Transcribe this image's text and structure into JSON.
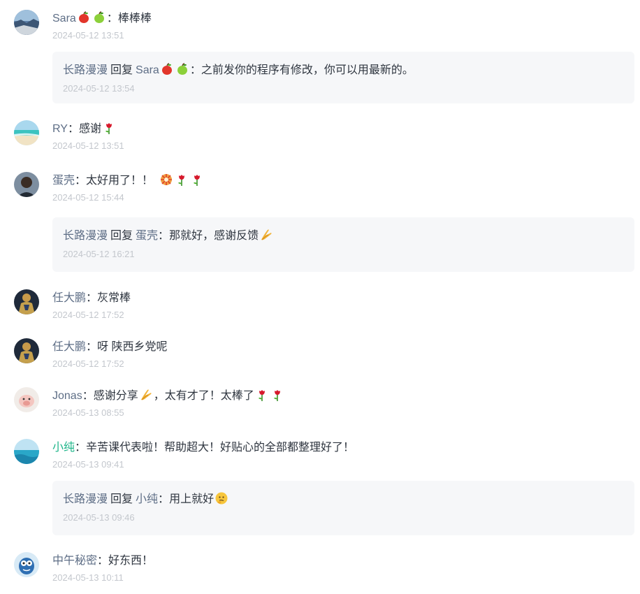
{
  "colon": "：",
  "reply_keyword": "回复",
  "comments": [
    {
      "author": "Sara",
      "author_emoji": [
        "apple-red-icon",
        "apple-green-icon"
      ],
      "text": "棒棒棒",
      "time": "2024-05-12 13:51",
      "avatar": "avatar-landscape-rocks",
      "replies": [
        {
          "author": "长路漫漫",
          "target": "Sara",
          "target_emoji": [
            "apple-red-icon",
            "apple-green-icon"
          ],
          "text": "之前发你的程序有修改，你可以用最新的。",
          "time": "2024-05-12 13:54"
        }
      ]
    },
    {
      "author": "RY",
      "text": "感谢",
      "text_emoji_after": [
        "rose-icon"
      ],
      "time": "2024-05-12 13:51",
      "avatar": "avatar-beach"
    },
    {
      "author": "蛋壳",
      "text": "太好用了！！",
      "text_emoji_after": [
        "party-popper-icon",
        "rose-icon",
        "rose-icon"
      ],
      "time": "2024-05-12 15:44",
      "avatar": "avatar-person-dark",
      "replies": [
        {
          "author": "长路漫漫",
          "target": "蛋壳",
          "text": "那就好，感谢反馈",
          "text_emoji_after": [
            "praying-hands-icon"
          ],
          "time": "2024-05-12 16:21"
        }
      ]
    },
    {
      "author": "任大鹏",
      "text": "灰常棒",
      "time": "2024-05-12 17:52",
      "avatar": "avatar-armored-figure"
    },
    {
      "author": "任大鹏",
      "text": "呀 陕西乡党呢",
      "time": "2024-05-12 17:52",
      "avatar": "avatar-armored-figure"
    },
    {
      "author": "Jonas",
      "text_parts": [
        "感谢分享",
        "，太有才了！太棒了"
      ],
      "text_emoji_mid": [
        "praying-hands-icon"
      ],
      "text_emoji_after": [
        "rose-icon",
        "rose-icon"
      ],
      "time": "2024-05-13 08:55",
      "avatar": "avatar-piglet"
    },
    {
      "author": "小纯",
      "author_color": "#1fb58a",
      "text": "辛苦课代表啦！帮助超大！好贴心的全部都整理好了！",
      "time": "2024-05-13 09:41",
      "avatar": "avatar-ocean",
      "replies": [
        {
          "author": "长路漫漫",
          "target": "小纯",
          "text": "用上就好",
          "text_emoji_after": [
            "thinking-face-icon"
          ],
          "time": "2024-05-13 09:46"
        }
      ]
    },
    {
      "author": "中午秘密",
      "text": "好东西！",
      "time": "2024-05-13 10:11",
      "avatar": "avatar-cartoon-face"
    }
  ]
}
